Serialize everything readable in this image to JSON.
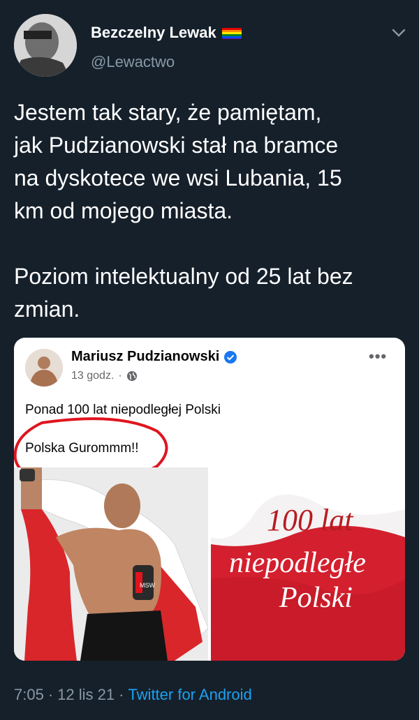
{
  "author": {
    "display_name": "Bezczelny Lewak",
    "handle": "@Lewactwo",
    "badge_icon": "rainbow-flag-icon"
  },
  "tweet": {
    "text": "Jestem tak stary, że pamiętam,\njak Pudzianowski stał na bramce\nna dyskotece we wsi Lubania, 15\nkm od mojego miasta.\n\nPoziom intelektualny od 25 lat bez\nzmian."
  },
  "embedded_post": {
    "author_name": "Mariusz Pudzianowski",
    "time": "13 godz.",
    "separator": "·",
    "line1": "Ponad 100 lat niepodległej Polski",
    "line2": "Polska Gurommm!!",
    "right_image": {
      "line1": "100 lat",
      "line2": "niepodległe",
      "line3": "Polski"
    },
    "shorts_label": "MSW"
  },
  "footer": {
    "time": "7:05",
    "dot1": "·",
    "date": "12 lis 21",
    "dot2": "·",
    "source": "Twitter for Android"
  },
  "colors": {
    "background": "#15202b",
    "secondary_text": "#8899a6",
    "link": "#1da1f2",
    "highlight_ring": "#e0141e"
  }
}
